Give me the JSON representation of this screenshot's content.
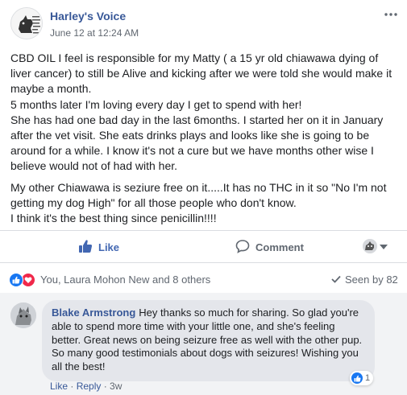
{
  "post": {
    "author": "Harley's Voice",
    "timestamp": "June 12 at 12:24 AM",
    "paragraphs": [
      "CBD OIL I feel is responsible for my Matty ( a 15 yr old chiawawa dying of liver cancer) to still be Alive and kicking after we were told she would make it maybe a month.\n5 months later I'm loving every day I get to spend with her!\nShe has had one bad day in the last 6months. I started her on it in January after the vet visit. She eats drinks plays and looks like she is going to be around for a while. I know it's not a cure but we have months other wise I believe would not of had with her.",
      "My other Chiawawa is seziure free on it.....It has no THC in it so \"No I'm not getting my dog High\" for all those people who don't know.\nI think it's the best thing since penicillin!!!!"
    ]
  },
  "actions": {
    "like_label": "Like",
    "comment_label": "Comment"
  },
  "reactions": {
    "names": "You, Laura Mohon New and 8 others",
    "seen_by": "Seen by 82"
  },
  "comment": {
    "author": "Blake Armstrong",
    "text": "Hey thanks so much for sharing. So glad you're able to spend more time with your little one, and she's feeling better. Great news on being seizure free as well with the other pup. So many good testimonials about dogs with seizures! Wishing you all the best!",
    "reaction_count": "1",
    "like_label": "Like",
    "separator": " · ",
    "reply_label": "Reply",
    "age": "3w"
  },
  "colors": {
    "link_blue": "#385898",
    "like_blue": "#4267b2",
    "love_red": "#f0284a",
    "secondary_text": "#606770",
    "comment_bg": "#f2f3f5"
  }
}
